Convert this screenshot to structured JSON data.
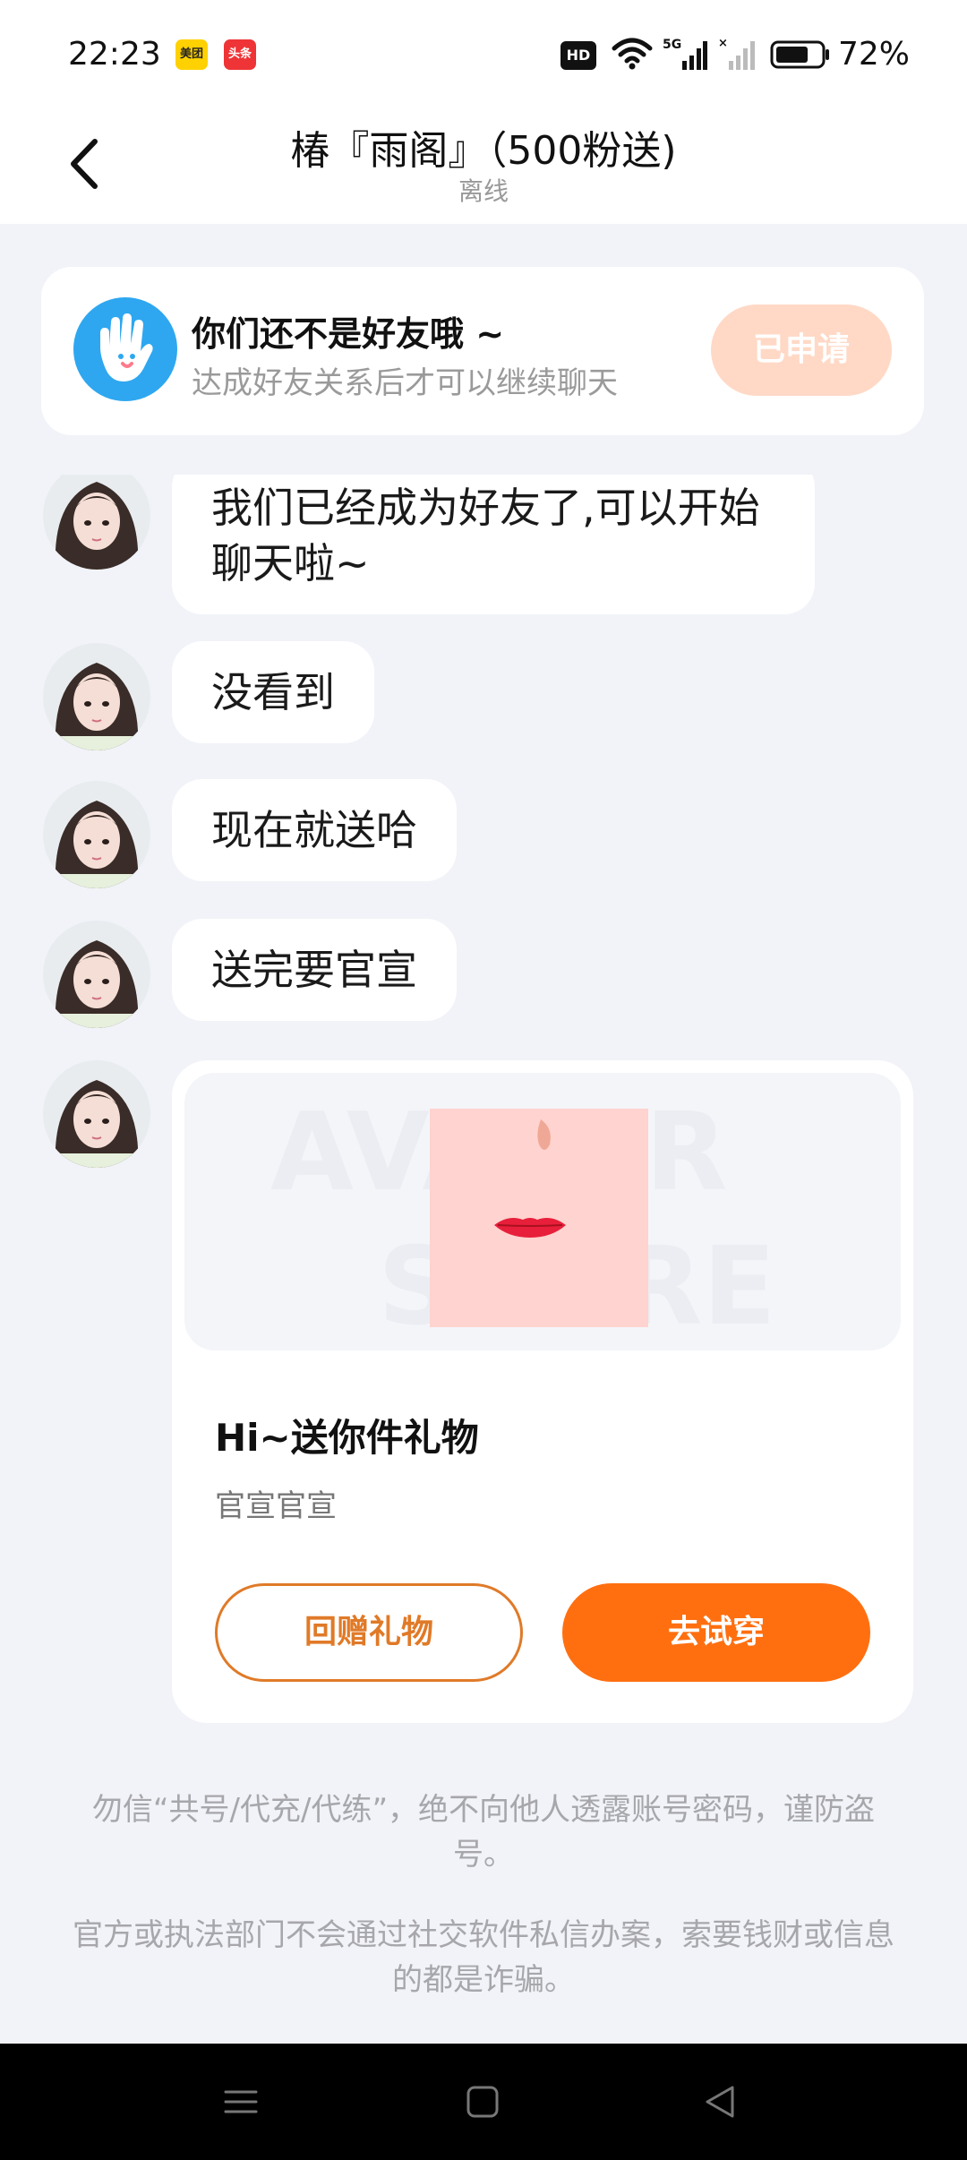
{
  "status_bar": {
    "time": "22:23",
    "app_badges": [
      "美团",
      "头条"
    ],
    "hd_label": "HD",
    "battery_percent": "72%",
    "battery_level": 0.72,
    "icons": [
      "hd-icon",
      "wifi-icon",
      "signal-5g-icon",
      "signal-no-sim-icon",
      "battery-icon"
    ]
  },
  "header": {
    "title": "椿『雨阁』（500粉送)",
    "status": "离线",
    "back_icon": "chevron-left-icon"
  },
  "friend_banner": {
    "icon": "hand-wave-icon",
    "title": "你们还不是好友哦 ~",
    "subtitle": "达成好友关系后才可以继续聊天",
    "button_label": "已申请"
  },
  "messages": [
    {
      "text": "我们已经成为好友了,可以开始聊天啦~"
    },
    {
      "text": "没看到"
    },
    {
      "text": "现在就送哈"
    },
    {
      "text": "送完要官宣"
    }
  ],
  "gift_card": {
    "watermark": "AVATAR STORE",
    "title": "Hi~送你件礼物",
    "subtitle": "官宣官宣",
    "return_button": "回赠礼物",
    "try_button": "去试穿"
  },
  "notices": [
    "勿信“共号/代充/代练”，绝不向他人透露账号密码，谨防盗号。",
    "官方或执法部门不会通过社交软件私信办案，索要钱财或信息的都是诈骗。"
  ],
  "nav_bar": {
    "icons": [
      "menu-icon",
      "home-icon",
      "back-triangle-icon"
    ]
  },
  "colors": {
    "accent_orange": "#ff6f10",
    "applied_button_bg": "#ffd9c6",
    "banner_icon_blue": "#2ea7f0",
    "page_bg": "#f1f3f8"
  }
}
